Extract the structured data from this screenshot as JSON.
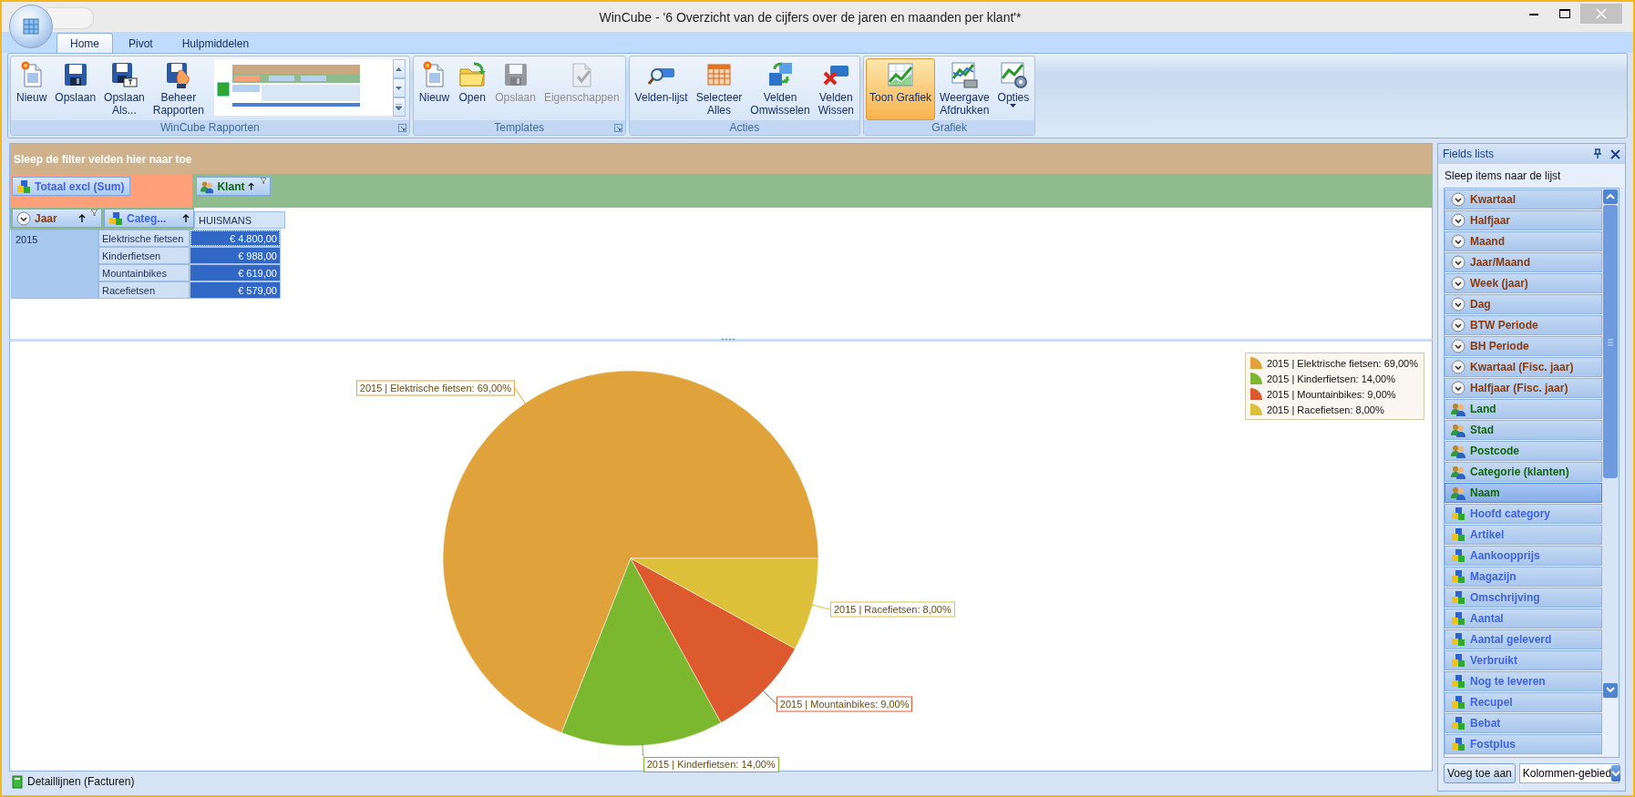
{
  "window": {
    "title": "WinCube - '6 Overzicht van de cijfers over de jaren en maanden per klant'*"
  },
  "tabs": [
    {
      "label": "Home",
      "selected": true
    },
    {
      "label": "Pivot",
      "selected": false
    },
    {
      "label": "Hulpmiddelen",
      "selected": false
    }
  ],
  "ribbon": {
    "groups": [
      {
        "title": "WinCube Rapporten",
        "launcher": true,
        "has_gallery": true,
        "buttons": [
          {
            "label": "Nieuw",
            "kind": "new",
            "disabled": false,
            "pressed": false
          },
          {
            "label": "Opslaan",
            "kind": "save",
            "disabled": false,
            "pressed": false
          },
          {
            "label": "Opslaan\nAls...",
            "kind": "saveas",
            "disabled": false,
            "pressed": false
          },
          {
            "label": "Beheer\nRapporten",
            "kind": "manage",
            "disabled": false,
            "pressed": false
          }
        ]
      },
      {
        "title": "Templates",
        "launcher": true,
        "has_gallery": false,
        "buttons": [
          {
            "label": "Nieuw",
            "kind": "new",
            "disabled": false,
            "pressed": false
          },
          {
            "label": "Open",
            "kind": "open",
            "disabled": false,
            "pressed": false
          },
          {
            "label": "Opslaan",
            "kind": "save",
            "disabled": true,
            "pressed": false
          },
          {
            "label": "Eigenschappen",
            "kind": "properties",
            "disabled": true,
            "pressed": false
          }
        ]
      },
      {
        "title": "Acties",
        "launcher": false,
        "has_gallery": false,
        "buttons": [
          {
            "label": "Velden-lijst",
            "kind": "fieldlist",
            "disabled": false,
            "pressed": false
          },
          {
            "label": "Selecteer\nAlles",
            "kind": "selectall",
            "disabled": false,
            "pressed": false
          },
          {
            "label": "Velden\nOmwisselen",
            "kind": "swap",
            "disabled": false,
            "pressed": false
          },
          {
            "label": "Velden\nWissen",
            "kind": "clear",
            "disabled": false,
            "pressed": false
          }
        ]
      },
      {
        "title": "Grafiek",
        "launcher": false,
        "has_gallery": false,
        "buttons": [
          {
            "label": "Toon Grafiek",
            "kind": "chart",
            "disabled": false,
            "pressed": true
          },
          {
            "label": "Weergave\nAfdrukken",
            "kind": "print",
            "disabled": false,
            "pressed": false
          },
          {
            "label": "Opties",
            "kind": "options",
            "disabled": false,
            "pressed": false
          }
        ]
      }
    ]
  },
  "pivot": {
    "filter_hint": "Sleep de filter velden hier naar toe",
    "data_fields": [
      {
        "label": "Totaal excl (Sum)",
        "kind": "measure",
        "sorted": false,
        "filtered": false
      }
    ],
    "column_fields": [
      {
        "label": "Klant",
        "kind": "customer",
        "sorted": true,
        "filtered": true
      }
    ],
    "row_fields": [
      {
        "label": "Jaar",
        "kind": "date",
        "sorted": true,
        "filtered": true
      },
      {
        "label": "Categ...",
        "kind": "measure",
        "sorted": true,
        "filtered": false
      }
    ],
    "column_headers": [
      "HUISMANS"
    ],
    "row_groups": [
      {
        "label": "2015",
        "rows": [
          {
            "category": "Elektrische fietsen",
            "value": "€ 4.800,00",
            "focused": true
          },
          {
            "category": "Kinderfietsen",
            "value": "€ 988,00",
            "focused": false
          },
          {
            "category": "Mountainbikes",
            "value": "€ 619,00",
            "focused": false
          },
          {
            "category": "Racefietsen",
            "value": "€ 579,00",
            "focused": false
          }
        ]
      }
    ]
  },
  "chart": {
    "chart_data": {
      "type": "pie",
      "values": [
        69,
        14,
        9,
        8
      ],
      "value_labels": [
        "2015 | Elektrische fietsen: 69,00%",
        "2015 | Kinderfietsen: 14,00%",
        "2015 | Mountainbikes: 9,00%",
        "2015 | Racefietsen: 8,00%"
      ]
    },
    "legend": [
      {
        "label": "2015 | Elektrische fietsen: 69,00%",
        "color": "#e0a33c"
      },
      {
        "label": "2015 | Kinderfietsen: 14,00%",
        "color": "#7cb82f"
      },
      {
        "label": "2015 | Mountainbikes: 9,00%",
        "color": "#dd5a2e"
      },
      {
        "label": "2015 | Racefietsen: 8,00%",
        "color": "#dcc03a"
      }
    ]
  },
  "fields_panel": {
    "title": "Fields lists",
    "hint": "Sleep items naar de lijst",
    "items": [
      {
        "label": "Kwartaal",
        "kind": "date",
        "selected": false
      },
      {
        "label": "Halfjaar",
        "kind": "date",
        "selected": false
      },
      {
        "label": "Maand",
        "kind": "date",
        "selected": false
      },
      {
        "label": "Jaar/Maand",
        "kind": "date",
        "selected": false
      },
      {
        "label": "Week (jaar)",
        "kind": "date",
        "selected": false
      },
      {
        "label": "Dag",
        "kind": "date",
        "selected": false
      },
      {
        "label": "BTW Periode",
        "kind": "date",
        "selected": false
      },
      {
        "label": "BH Periode",
        "kind": "date",
        "selected": false
      },
      {
        "label": "Kwartaal (Fisc. jaar)",
        "kind": "date",
        "selected": false
      },
      {
        "label": "Halfjaar (Fisc. jaar)",
        "kind": "date",
        "selected": false
      },
      {
        "label": "Land",
        "kind": "customer",
        "selected": false
      },
      {
        "label": "Stad",
        "kind": "customer",
        "selected": false
      },
      {
        "label": "Postcode",
        "kind": "customer",
        "selected": false
      },
      {
        "label": "Categorie (klanten)",
        "kind": "customer",
        "selected": false
      },
      {
        "label": "Naam",
        "kind": "customer",
        "selected": true
      },
      {
        "label": "Hoofd category",
        "kind": "measure",
        "selected": false
      },
      {
        "label": "Artikel",
        "kind": "measure",
        "selected": false
      },
      {
        "label": "Aankoopprijs",
        "kind": "measure",
        "selected": false
      },
      {
        "label": "Magazijn",
        "kind": "measure",
        "selected": false
      },
      {
        "label": "Omschrijving",
        "kind": "measure",
        "selected": false
      },
      {
        "label": "Aantal",
        "kind": "measure",
        "selected": false
      },
      {
        "label": "Aantal geleverd",
        "kind": "measure",
        "selected": false
      },
      {
        "label": "Verbruikt",
        "kind": "measure",
        "selected": false
      },
      {
        "label": "Nog te leveren",
        "kind": "measure",
        "selected": false
      },
      {
        "label": "Recupel",
        "kind": "measure",
        "selected": false
      },
      {
        "label": "Bebat",
        "kind": "measure",
        "selected": false
      },
      {
        "label": "Fostplus",
        "kind": "measure",
        "selected": false
      }
    ],
    "add_button": "Voeg toe aan",
    "target": {
      "value": "Kolommen-gebied"
    }
  },
  "status_bar": {
    "text": "Detaillijnen (Facturen)"
  }
}
